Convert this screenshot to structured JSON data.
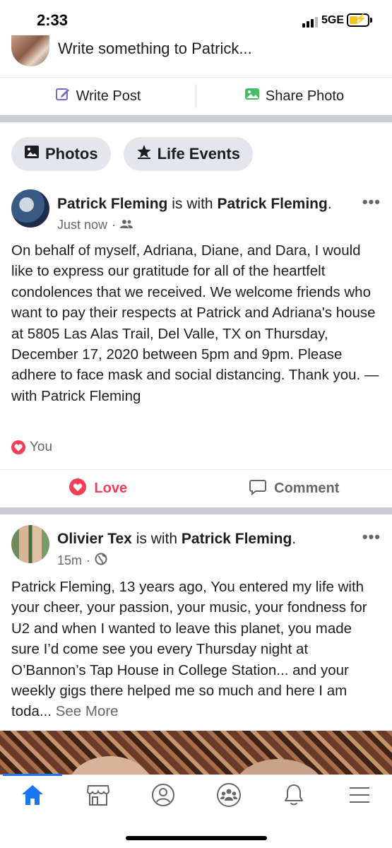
{
  "status_bar": {
    "time": "2:33",
    "network": "5GE"
  },
  "composer": {
    "prompt": "Write something to Patrick...",
    "write_post": "Write Post",
    "share_photo": "Share Photo"
  },
  "chips": {
    "photos": "Photos",
    "life_events": "Life Events"
  },
  "posts": [
    {
      "author": "Patrick Fleming",
      "with_text": "is with",
      "tagged": "Patrick Fleming",
      "timestamp": "Just now",
      "audience_icon": "friends-icon",
      "body": "On behalf of myself, Adriana, Diane, and Dara, I would like to express our gratitude for all of the heartfelt condolences that we received.  We welcome friends who want to pay their respects at Patrick and Adriana's house at 5805 Las Alas Trail, Del Valle, TX on Thursday, December 17, 2020 between 5pm and 9pm.  Please adhere to face mask and social distancing.  Thank you. — with Patrick Fleming",
      "reaction_text": "You",
      "love_label": "Love",
      "comment_label": "Comment"
    },
    {
      "author": "Olivier Tex",
      "with_text": "is with",
      "tagged": "Patrick Fleming",
      "timestamp": "15m",
      "audience_icon": "globe-icon",
      "body": "Patrick Fleming, 13 years ago, You entered my life with your cheer, your passion, your music, your fondness for U2 and when I wanted to leave this planet, you made sure I’d come see you every Thursday night at O’Bannon’s Tap House in College Station... and your weekly gigs there helped me so much and here I am toda...",
      "see_more": "See More"
    }
  ],
  "nav": {
    "active": "home",
    "items": [
      "home-icon",
      "marketplace-icon",
      "profile-icon",
      "groups-icon",
      "notifications-icon",
      "menu-icon"
    ]
  },
  "colors": {
    "accent": "#1877f2",
    "love": "#f33e58",
    "secondary_text": "#65676b",
    "separator": "#c9ccd1"
  }
}
